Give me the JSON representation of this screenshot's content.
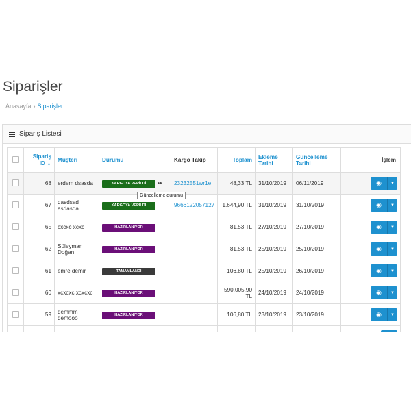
{
  "page": {
    "title": "Siparişler"
  },
  "breadcrumb": {
    "home": "Anasayfa",
    "separator": "›",
    "current": "Siparişler"
  },
  "panel": {
    "title": "Sipariş Listesi"
  },
  "columns": {
    "id": "Sipariş ID",
    "customer": "Müşteri",
    "status": "Durumu",
    "tracking": "Kargo Takip",
    "total": "Toplam",
    "added": "Ekleme Tarihi",
    "updated": "Güncelleme Tarihi",
    "action": "İşlem"
  },
  "status_colors": {
    "KARGOYA VERİLDİ": "#1a6e1a",
    "HAZIRLANIYOR": "#6b0f78",
    "TAMAMLANDI": "#3a3a3a"
  },
  "tooltip": "Güncelleme durumu",
  "orders": [
    {
      "id": "68",
      "customer": "erdem dsasda",
      "status": "KARGOYA VERİLDİ",
      "tracking": "23232551wr1e",
      "total": "48,33 TL",
      "added": "31/10/2019",
      "updated": "06/11/2019"
    },
    {
      "id": "67",
      "customer": "dasdsad asdasda",
      "status": "KARGOYA VERİLDİ",
      "tracking": "9666122057127",
      "total": "1.644,90 TL",
      "added": "31/10/2019",
      "updated": "31/10/2019"
    },
    {
      "id": "65",
      "customer": "cxcxc xcxc",
      "status": "HAZIRLANIYOR",
      "tracking": "",
      "total": "81,53 TL",
      "added": "27/10/2019",
      "updated": "27/10/2019"
    },
    {
      "id": "62",
      "customer": "Süleyman Doğan",
      "status": "HAZIRLANIYOR",
      "tracking": "",
      "total": "81,53 TL",
      "added": "25/10/2019",
      "updated": "25/10/2019"
    },
    {
      "id": "61",
      "customer": "emre demir",
      "status": "TAMAMLANDI",
      "tracking": "",
      "total": "106,80 TL",
      "added": "25/10/2019",
      "updated": "26/10/2019"
    },
    {
      "id": "60",
      "customer": "xcxcxc xcxcxc",
      "status": "HAZIRLANIYOR",
      "tracking": "",
      "total": "590.005,90 TL",
      "added": "24/10/2019",
      "updated": "24/10/2019"
    },
    {
      "id": "59",
      "customer": "demmm demooo",
      "status": "HAZIRLANIYOR",
      "tracking": "",
      "total": "106,80 TL",
      "added": "23/10/2019",
      "updated": "23/10/2019"
    },
    {
      "id": "",
      "customer": "",
      "status": "",
      "tracking": "",
      "total": "",
      "added": "",
      "updated": ""
    }
  ]
}
